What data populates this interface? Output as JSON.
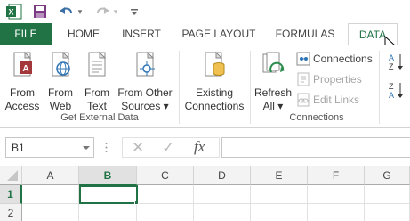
{
  "qat": {
    "icons": [
      "excel-logo-icon",
      "save-icon",
      "undo-icon",
      "redo-icon",
      "customize-qat-icon"
    ],
    "undo_dropdown": "▾",
    "redo_dropdown": "▾"
  },
  "tabs": [
    {
      "label": "FILE"
    },
    {
      "label": "HOME"
    },
    {
      "label": "INSERT"
    },
    {
      "label": "PAGE LAYOUT"
    },
    {
      "label": "FORMULAS"
    },
    {
      "label": "DATA"
    }
  ],
  "ribbon": {
    "get_external": {
      "from_access": [
        "From",
        "Access"
      ],
      "from_web": [
        "From",
        "Web"
      ],
      "from_text": [
        "From",
        "Text"
      ],
      "from_other": [
        "From Other",
        "Sources ▾"
      ],
      "group_label": "Get External Data"
    },
    "existing": [
      "Existing",
      "Connections"
    ],
    "connections": {
      "refresh": [
        "Refresh",
        "All ▾"
      ],
      "connections": "Connections",
      "properties": "Properties",
      "edit_links": "Edit Links",
      "group_label": "Connections"
    },
    "sort": {
      "az": "A Z ↓",
      "za": "Z A ↓"
    }
  },
  "formula_bar": {
    "name_box": "B1",
    "cancel": "✕",
    "enter": "✓",
    "fx": "fx",
    "formula": ""
  },
  "grid": {
    "columns": [
      "A",
      "B",
      "C",
      "D",
      "E",
      "F",
      "G"
    ],
    "rows": [
      "1",
      "2"
    ],
    "selected": "B1"
  },
  "colors": {
    "accent": "#217346"
  }
}
